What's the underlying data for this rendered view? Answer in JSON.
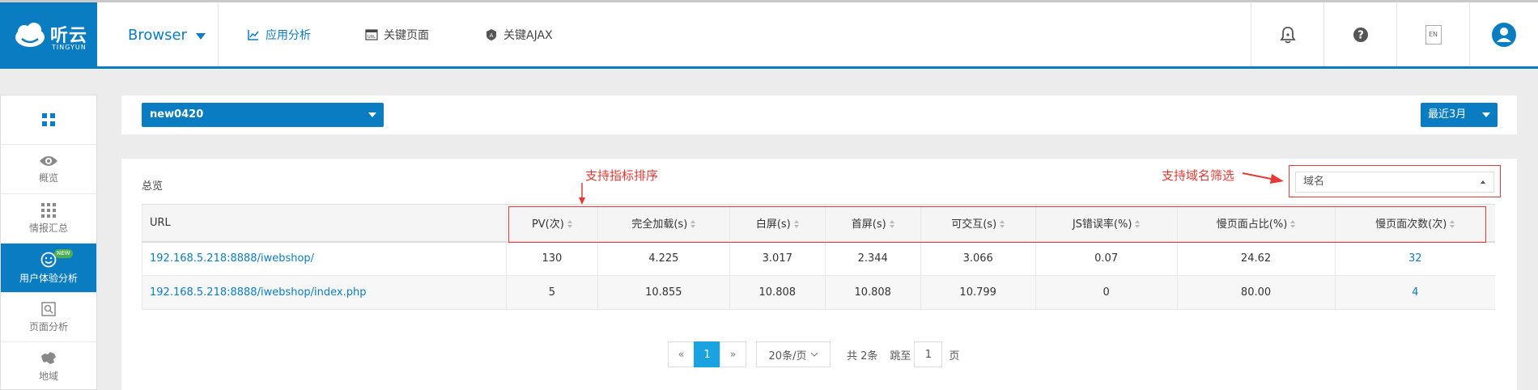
{
  "header": {
    "logo": {
      "brand_cn": "听云",
      "brand_en": "TINGYUN"
    },
    "product_label": "Browser",
    "nav": [
      {
        "label": "应用分析",
        "icon": "line-chart-icon",
        "active": true
      },
      {
        "label": "关键页面",
        "icon": "url-icon",
        "active": false
      },
      {
        "label": "关键AJAX",
        "icon": "ajax-shield-icon",
        "active": false
      }
    ],
    "tools": {
      "bell": "bell-icon",
      "help": "help-icon",
      "language": "EN",
      "user": "user-icon"
    }
  },
  "sidebar": {
    "items": [
      {
        "label": "",
        "icon": "grid-icon"
      },
      {
        "label": "概览",
        "icon": "eye-icon"
      },
      {
        "label": "情报汇总",
        "icon": "apps-icon"
      },
      {
        "label": "用户体验分析",
        "icon": "smile-icon",
        "badge": "NEW",
        "active": true
      },
      {
        "label": "页面分析",
        "icon": "page-search-icon"
      },
      {
        "label": "地域",
        "icon": "map-icon"
      }
    ]
  },
  "filters": {
    "app": "new0420",
    "time_range": "最近3月"
  },
  "panel": {
    "title": "总览",
    "domain_placeholder": "域名",
    "annotations": {
      "sort": "支持指标排序",
      "domain": "支持域名筛选"
    },
    "table": {
      "columns": [
        "URL",
        "PV(次)",
        "完全加载(s)",
        "白屏(s)",
        "首屏(s)",
        "可交互(s)",
        "JS错误率(%)",
        "慢页面占比(%)",
        "慢页面次数(次)"
      ],
      "rows": [
        [
          "192.168.5.218:8888/iwebshop/",
          "130",
          "4.225",
          "3.017",
          "2.344",
          "3.066",
          "0.07",
          "24.62",
          "32"
        ],
        [
          "192.168.5.218:8888/iwebshop/index.php",
          "5",
          "10.855",
          "10.808",
          "10.808",
          "10.799",
          "0",
          "80.00",
          "4"
        ]
      ]
    },
    "pagination": {
      "prev": "«",
      "current": "1",
      "next": "»",
      "page_size": "20条/页",
      "total": "共 2条",
      "jump_label": "跳至",
      "jump_value": "1",
      "jump_unit": "页"
    }
  },
  "colors": {
    "brand": "#0a7dc2",
    "annotation": "#e53935",
    "pager_active": "#1aa3e0"
  }
}
